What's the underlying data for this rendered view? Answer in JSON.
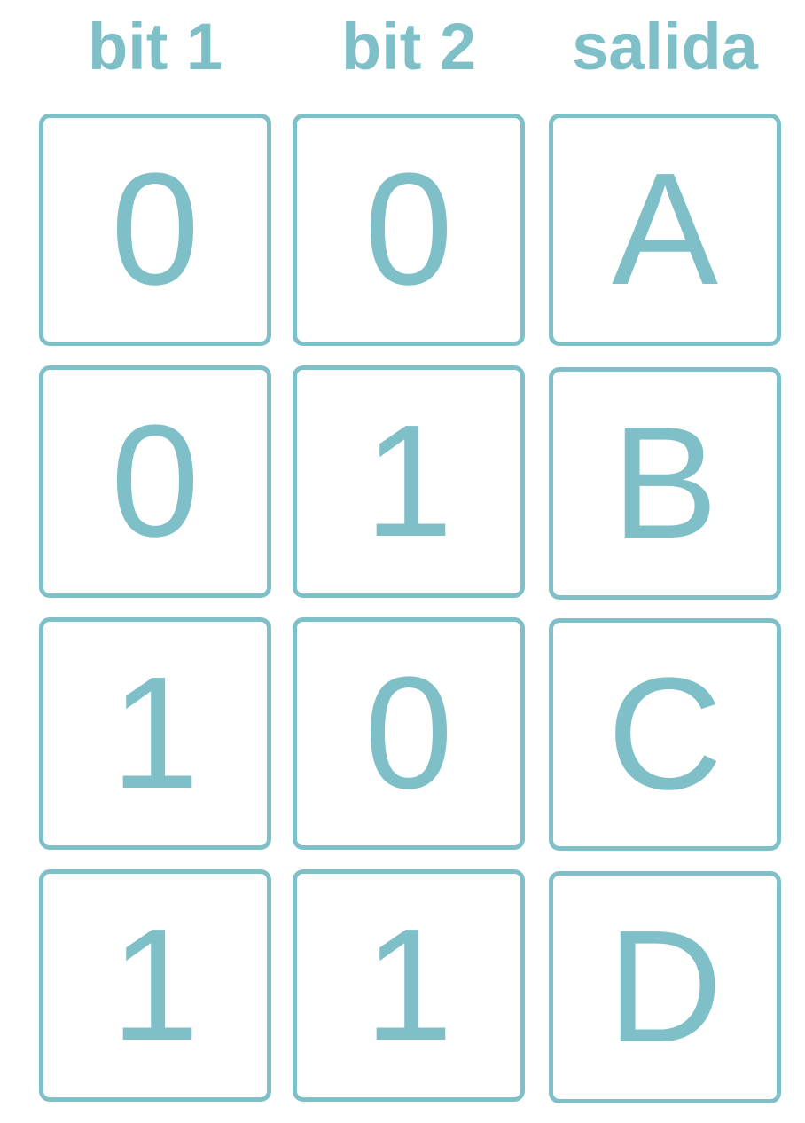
{
  "colors": {
    "accent": "#7fbfc7"
  },
  "headers": [
    "bit 1",
    "bit 2",
    "salida"
  ],
  "rows": [
    [
      "0",
      "0",
      "A"
    ],
    [
      "0",
      "1",
      "B"
    ],
    [
      "1",
      "0",
      "C"
    ],
    [
      "1",
      "1",
      "D"
    ]
  ]
}
